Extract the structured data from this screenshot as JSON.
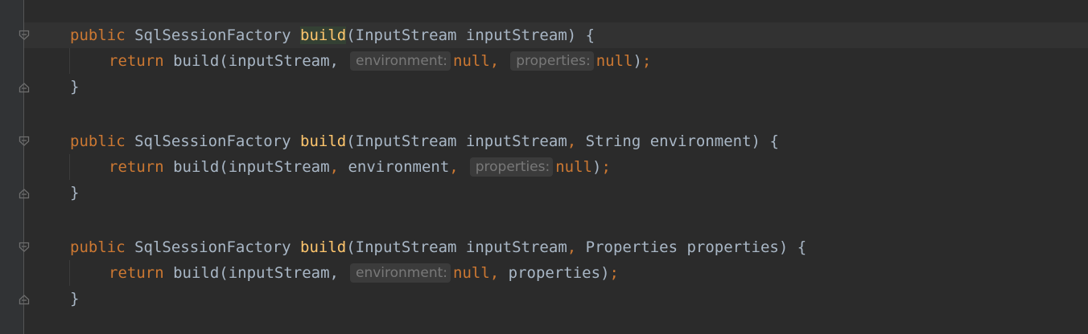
{
  "code": {
    "methods": [
      {
        "signature": {
          "keyword": "public",
          "return_type": "SqlSessionFactory",
          "method_name": "build",
          "params": "(InputStream inputStream)",
          "open_brace": " {"
        },
        "body": {
          "keyword": "return",
          "call": "build(inputStream,",
          "hint_environment": "environment:",
          "arg_environment": "null",
          "comma_after_environment": ",",
          "hint_properties": "properties:",
          "arg_properties": "null",
          "close_paren": ")",
          "semicolon": ";"
        },
        "close_brace": "}"
      },
      {
        "signature": {
          "keyword": "public",
          "return_type": "SqlSessionFactory",
          "method_name": "build",
          "params_part1": "(InputStream inputStream",
          "params_comma": ",",
          "params_part2": " String environment)",
          "open_brace": " {"
        },
        "body": {
          "keyword": "return",
          "call_part1": "build(inputStream",
          "comma1": ",",
          "call_part2": " environment",
          "comma2": ",",
          "hint_properties": "properties:",
          "arg_properties": "null",
          "close_paren": ")",
          "semicolon": ";"
        },
        "close_brace": "}"
      },
      {
        "signature": {
          "keyword": "public",
          "return_type": "SqlSessionFactory",
          "method_name": "build",
          "params_part1": "(InputStream inputStream",
          "params_comma": ",",
          "params_part2": " Properties properties)",
          "open_brace": " {"
        },
        "body": {
          "keyword": "return",
          "call": "build(inputStream,",
          "hint_environment": "environment:",
          "arg_environment": "null",
          "comma_after_environment": ",",
          "arg_properties": " properties",
          "close_paren": ")",
          "semicolon": ";"
        },
        "close_brace": "}"
      }
    ]
  },
  "colors": {
    "background": "#2b2b2b",
    "keyword": "#cc7832",
    "function": "#ffc66d",
    "plain": "#a9b7c6",
    "hint": "#787878"
  },
  "icons": [
    "fold-start-icon",
    "fold-end-icon"
  ]
}
